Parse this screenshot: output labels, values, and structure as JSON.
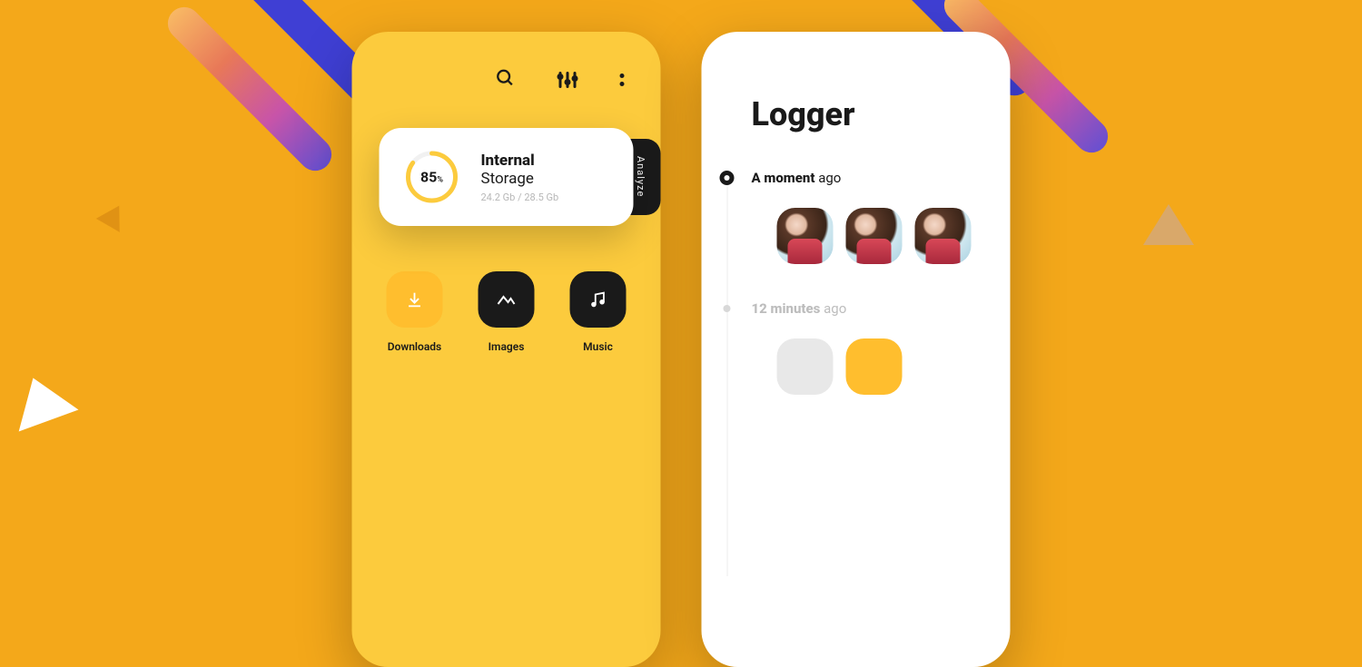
{
  "left": {
    "storage": {
      "percent": "85",
      "percent_unit": "%",
      "title_bold": "Internal",
      "title_light": "Storage",
      "usage": "24.2 Gb / 28.5 Gb",
      "analyze_label": "Analyze"
    },
    "categories": [
      {
        "label": "Downloads",
        "icon": "download-icon",
        "tone": "light"
      },
      {
        "label": "Images",
        "icon": "images-icon",
        "tone": "dark"
      },
      {
        "label": "Music",
        "icon": "music-icon",
        "tone": "dark"
      }
    ]
  },
  "right": {
    "title": "Logger",
    "timeline": [
      {
        "bold": "A moment",
        "light": "ago",
        "dot": "big",
        "muted": false,
        "thumbs": [
          "photo",
          "photo",
          "photo"
        ]
      },
      {
        "bold": "12 minutes",
        "light": "ago",
        "dot": "small",
        "muted": true,
        "thumbs": [
          "grey",
          "yellow"
        ]
      }
    ]
  }
}
